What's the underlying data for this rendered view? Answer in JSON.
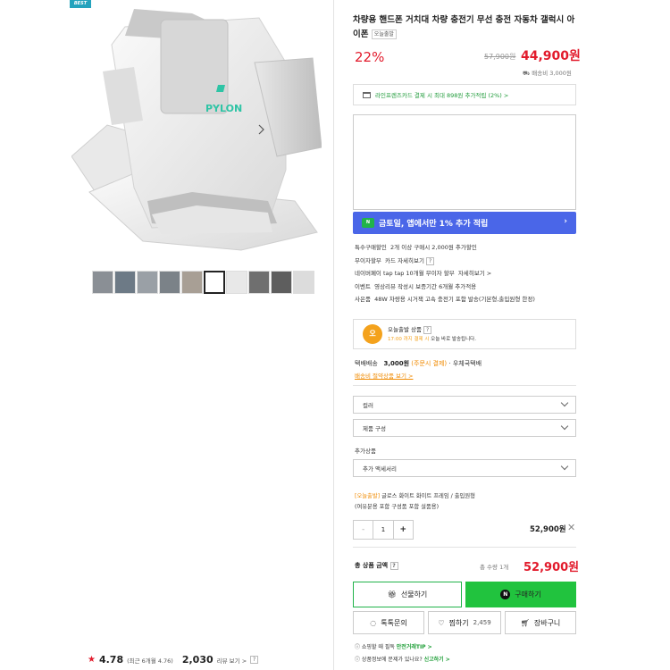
{
  "badge": "BEST",
  "product": {
    "title": "차량용 핸드폰 거치대 차량 충전기 무선 충전 자동차 갤럭시 아이폰",
    "title_tag": "오늘출발",
    "discount": "22%",
    "original_price": "57,900원",
    "price": "44,900원",
    "shipping_fee": "배송비 3,000원",
    "logo_text": "PYLON"
  },
  "card_banner": "라인프렌즈카드 결제 시 최대 898원 추가적립 (2%) >",
  "promo_banner": {
    "icon": "N",
    "text": "금토일, 앱에서만 1% 추가 적립",
    "arrow": "›"
  },
  "info_lines": [
    {
      "label": "특수구매할인",
      "text": "2개 이상 구매시 2,000원 추가할인"
    },
    {
      "label": "무이자할부",
      "text": "카드 자세히보기"
    },
    {
      "label": "네이버페이 tap tap 10개월 무이자 할부",
      "text": "자세히보기 >"
    },
    {
      "label": "이벤트",
      "text": "영상리뷰 작성시 보증기간 6개월 추가적용"
    },
    {
      "label": "사은품",
      "text": "48W 차량용 시거잭 고속 충전기 포함 발송(기본형,출입원형 한정)"
    }
  ],
  "today_delivery": {
    "icon": "오",
    "title": "오늘출발 상품",
    "time": "17:00 까지 결제 시",
    "sub": "오늘 바로 발송됩니다."
  },
  "delivery": {
    "label": "택배배송",
    "fee": "3,000원",
    "pay": "(주문시 결제)",
    "company": "· 우체국택배",
    "link": "배송비 절약상품 보기 >"
  },
  "selects": {
    "color": "컬러",
    "composition": "제품 구성",
    "add_label": "추가상품",
    "add_option": "추가 액세서리"
  },
  "selected_option": {
    "line1_tag": "[오늘출발]",
    "line1": " 글로스 화이트 화이트 프레임 / 출입원형",
    "line2": "(여유분용 포함 구성품 포함 설품용)"
  },
  "stepper": {
    "minus": "-",
    "qty": "1",
    "plus": "+"
  },
  "line_price": "52,900원",
  "remove": "✕",
  "total": {
    "label": "총 상품 금액",
    "count": "총 수량 1개",
    "price": "52,900원"
  },
  "buttons": {
    "gift": "선물하기",
    "buy": "구매하기",
    "talk": "톡톡문의",
    "wish": "찜하기",
    "wish_count": "2,459",
    "cart": "장바구니"
  },
  "notices": {
    "n1_text": "쇼핑할 때 필독",
    "n1_link": "안전거래TIP >",
    "n2_text": "상품정보에 문제가 있나요?",
    "n2_link": "신고하기 >"
  },
  "rating": {
    "star": "★",
    "value": "4.78",
    "sub": "(최근 6개월 4.76)",
    "reviews": "2,030",
    "reviews_label": "리뷰 보기 >",
    "help": "?"
  },
  "colors": {
    "red": "#e21b2c",
    "green": "#21c33e",
    "blue_banner": "#4a66e8",
    "orange": "#f08a00"
  }
}
